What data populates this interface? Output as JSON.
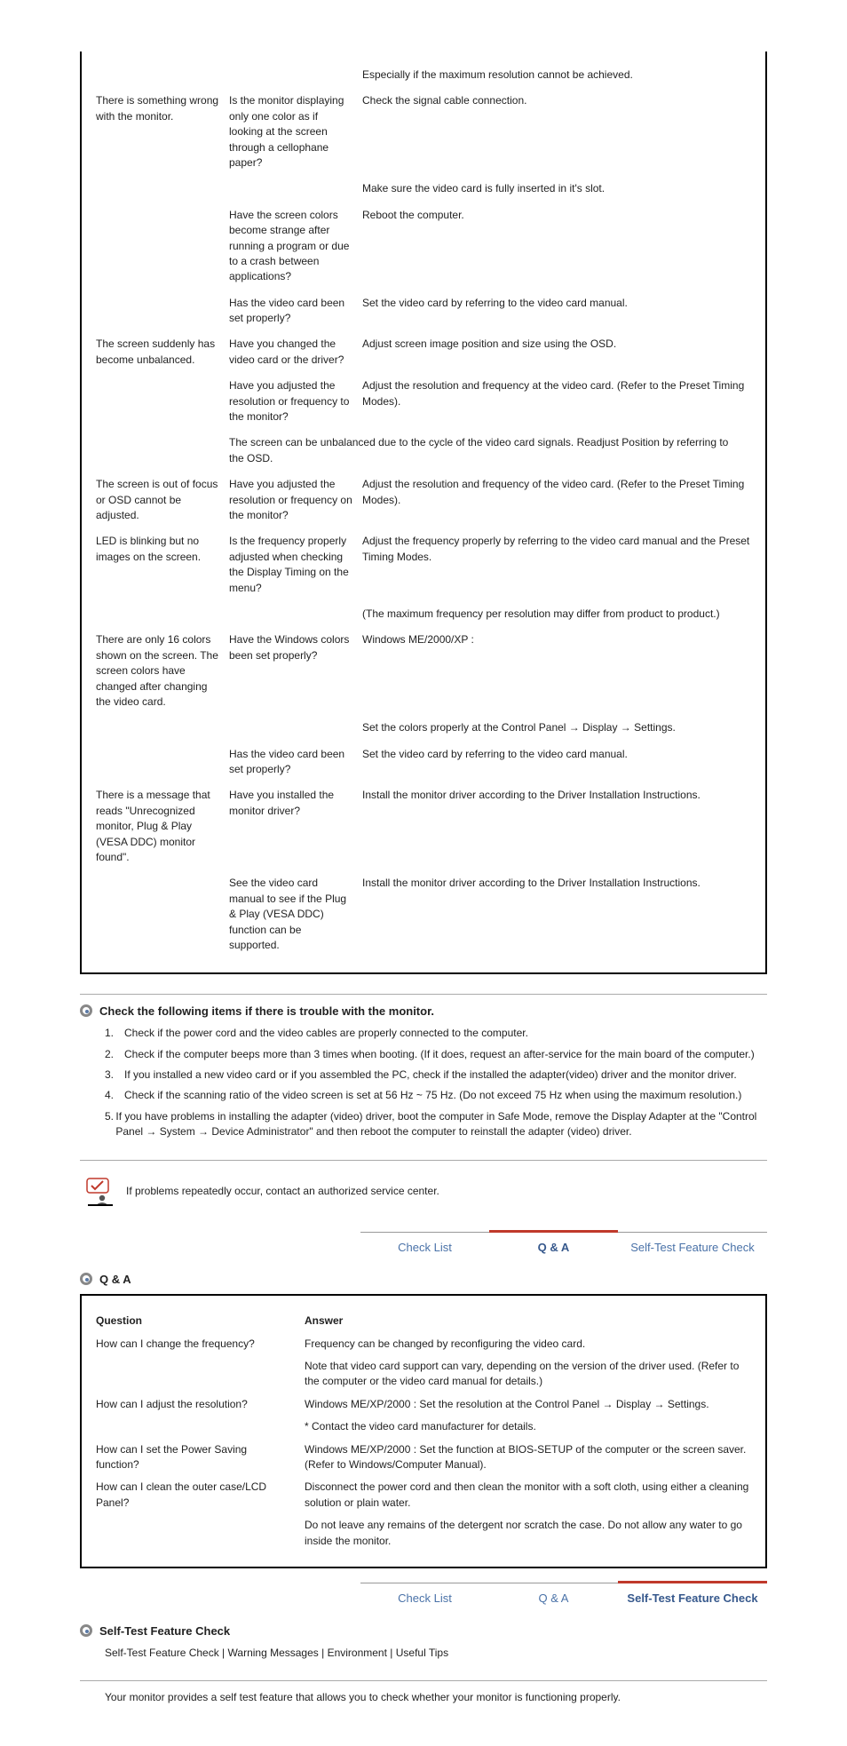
{
  "box1": {
    "rows": [
      {
        "label": "",
        "sub": "",
        "text": "Especially if the maximum resolution cannot be achieved."
      },
      {
        "label": "There is something wrong with the monitor.",
        "sub": "Is the monitor displaying only one color as if looking at the screen through a cellophane paper?",
        "text": "Check the signal cable connection."
      },
      {
        "label": "",
        "sub": "",
        "text": "Make sure the video card is fully inserted in it's slot."
      },
      {
        "label": "",
        "sub": "Have the screen colors become strange after running a program or due to a crash between applications?",
        "text": "Reboot the computer."
      },
      {
        "label": "",
        "sub": "Has the video card been set properly?",
        "text": "Set the video card by referring to the video card manual."
      },
      {
        "label": "The screen suddenly has become unbalanced.",
        "sub": "Have you changed the video card or the driver?",
        "text": "Adjust screen image position and size using the OSD."
      },
      {
        "label": "",
        "sub": "Have you adjusted the resolution or frequency to the monitor?",
        "text": "Adjust the resolution and frequency at the video card. (Refer to the Preset Timing Modes)."
      },
      {
        "label": "",
        "sub": "The screen can be unbalanced due to the cycle of the video card signals. Readjust Position by referring to the OSD.",
        "text": ""
      },
      {
        "label": "The screen is out of focus or OSD cannot be adjusted.",
        "sub": "Have you adjusted the resolution or frequency on the monitor?",
        "text": "Adjust the resolution and frequency of the video card. (Refer to the Preset Timing Modes)."
      },
      {
        "label": "LED is blinking but no images on the screen.",
        "sub": "Is the frequency properly adjusted when checking the Display Timing on the menu?",
        "text": "Adjust the frequency properly by referring to the video card manual and the Preset Timing Modes."
      },
      {
        "label": "",
        "sub": "",
        "text": "(The maximum frequency per resolution may differ from product to product.)"
      },
      {
        "label": "There are only 16 colors shown on the screen. The screen colors have changed after changing the video card.",
        "sub": "Have the Windows colors been set properly?",
        "text": "Windows ME/2000/XP :"
      },
      {
        "label": "",
        "sub": "",
        "text": "Set the colors properly at the Control Panel → Display → Settings."
      },
      {
        "label": "",
        "sub": "Has the video card been set properly?",
        "text": "Set the video card by referring to the video card manual."
      },
      {
        "label": "There is a message that reads \"Unrecognized monitor, Plug & Play (VESA DDC) monitor found\".",
        "sub": "Have you installed the monitor driver?",
        "text": "Install the monitor driver according to the Driver Installation Instructions."
      },
      {
        "label": "",
        "sub": "See the video card manual to see if the Plug & Play (VESA DDC) function can be supported.",
        "text": "Install the monitor driver according to the Driver Installation Instructions."
      }
    ]
  },
  "section_problems": {
    "title": "Check the following items if there is trouble with the monitor.",
    "items": [
      "Check if the power cord and the video cables are properly connected to the computer.",
      "Check if the computer beeps more than 3 times when booting. (If it does, request an after-service for the main board of the computer.)",
      "If you installed a new video card or if you assembled the PC, check if the installed the adapter(video) driver and the monitor driver.",
      "Check if the scanning ratio of the video screen is set at 56 Hz ~ 75 Hz. (Do not exceed 75 Hz when using the maximum resolution.)",
      "If you have problems in installing the adapter (video) driver, boot the computer in Safe Mode, remove the Display Adapter at the \"Control Panel → System → Device Administrator\" and then reboot the computer to reinstall the adapter (video) driver."
    ]
  },
  "tip": "If problems repeatedly occur, contact an authorized service center.",
  "tabs": {
    "check": "Check List",
    "qa": "Q & A",
    "selftest": "Self-Test Feature Check"
  },
  "qa_section": {
    "title": "Q & A",
    "headers": {
      "q": "Question",
      "a": "Answer"
    },
    "rows": [
      {
        "q": "How can I change the frequency?",
        "a": "Frequency can be changed by reconfiguring the video card."
      },
      {
        "q": "",
        "a": "Note that video card support can vary, depending on the version of the driver used. (Refer to the computer or the video card manual for details.)"
      },
      {
        "q": "How can I adjust the resolution?",
        "a": "Windows ME/XP/2000 : Set the resolution at the Control Panel → Display → Settings."
      },
      {
        "q": "",
        "a": "* Contact the video card manufacturer for details."
      },
      {
        "q": "How can I set the Power Saving function?",
        "a": "Windows ME/XP/2000 : Set the function at BIOS-SETUP of the computer or the screen saver. (Refer to Windows/Computer Manual)."
      },
      {
        "q": "How can I clean the outer case/LCD Panel?",
        "a": "Disconnect the power cord and then clean the monitor with a soft cloth, using either a cleaning solution or plain water."
      },
      {
        "q": "",
        "a": "Do not leave any remains of the detergent nor scratch the case. Do not allow any water to go inside the monitor."
      }
    ]
  },
  "selftest_section": {
    "title": "Self-Test Feature Check",
    "links": [
      "Self-Test Feature Check",
      "Warning Messages",
      "Environment",
      "Useful Tips"
    ],
    "text": "Your monitor provides a self test feature that allows you to check whether your monitor is functioning properly."
  }
}
